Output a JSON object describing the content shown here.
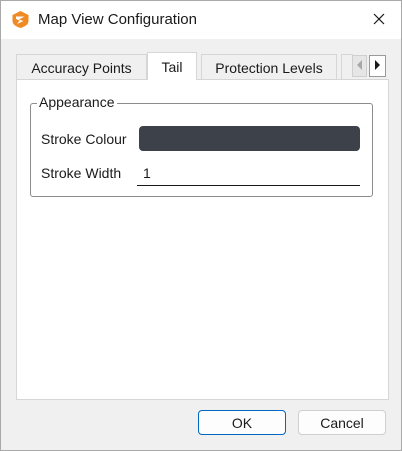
{
  "window": {
    "title": "Map View Configuration",
    "app_icon": "app-logo-icon",
    "close_icon": "close-icon"
  },
  "tabs": [
    {
      "label": "Accuracy Points",
      "selected": false
    },
    {
      "label": "Tail",
      "selected": true
    },
    {
      "label": "Protection Levels",
      "selected": false
    }
  ],
  "tab_scroll": {
    "left_icon": "chevron-left-icon",
    "right_icon": "chevron-right-icon"
  },
  "appearance": {
    "group_title": "Appearance",
    "stroke_colour_label": "Stroke Colour",
    "stroke_colour_value": "#3d424a",
    "stroke_width_label": "Stroke Width",
    "stroke_width_value": "1"
  },
  "buttons": {
    "ok_label": "OK",
    "cancel_label": "Cancel"
  },
  "colors": {
    "accent": "#0067c0",
    "app_icon_orange": "#f08a24"
  }
}
